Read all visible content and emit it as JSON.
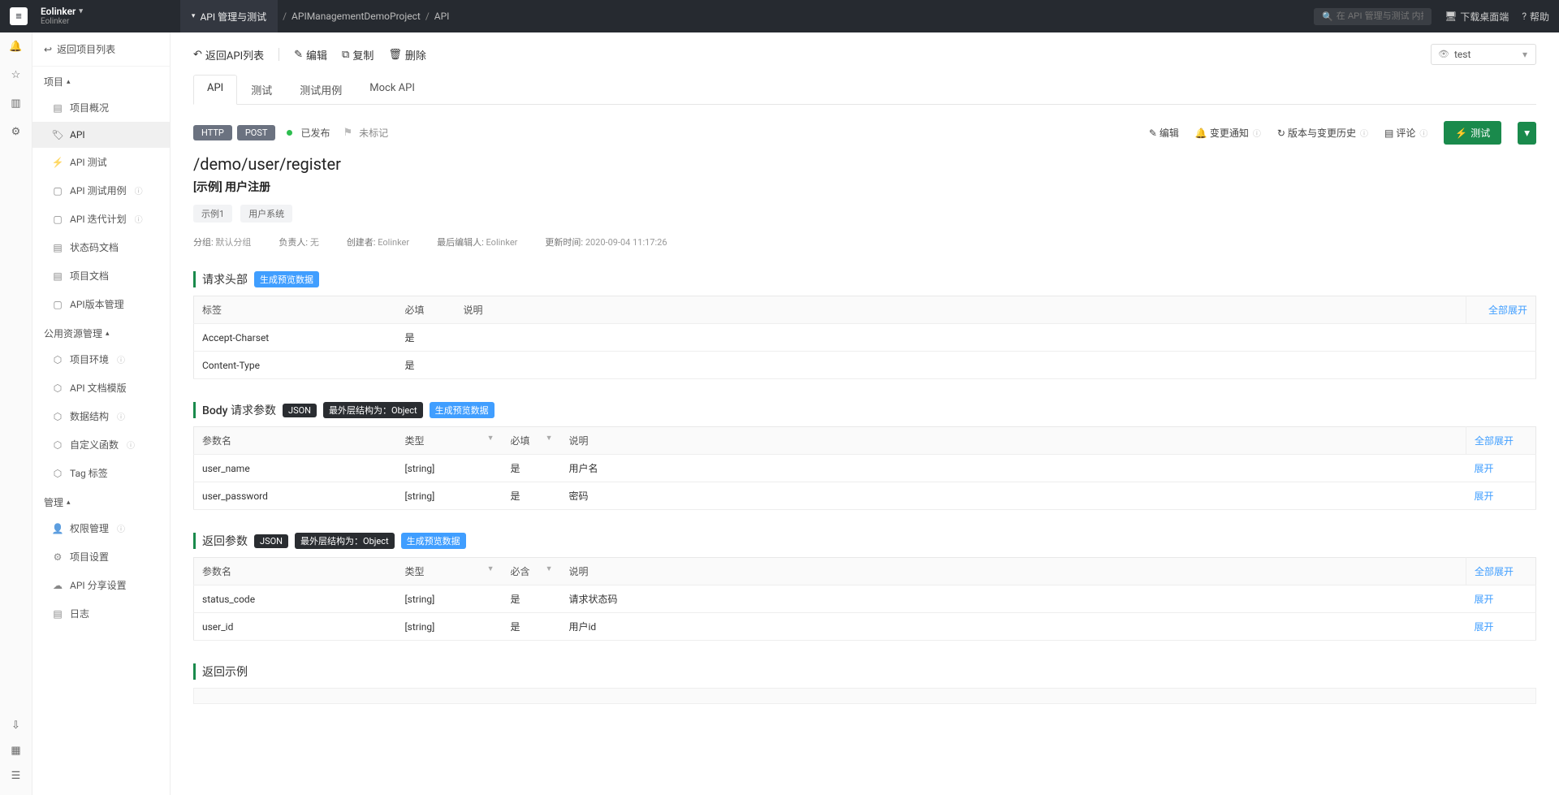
{
  "topbar": {
    "workspace_name": "Eolinker",
    "workspace_sub": "Eolinker",
    "breadcrumb_tab": "API 管理与测试",
    "breadcrumb_project": "APIManagementDemoProject",
    "breadcrumb_leaf": "API",
    "search_placeholder": "在 API 管理与测试 内搜索",
    "download": "下载桌面端",
    "help": "帮助"
  },
  "sidebar": {
    "back": "返回项目列表",
    "group1_title": "项目",
    "group1_items": [
      "项目概况",
      "API",
      "API 测试",
      "API 测试用例",
      "API 迭代计划",
      "状态码文档",
      "项目文档",
      "API版本管理"
    ],
    "group2_title": "公用资源管理",
    "group2_items": [
      "项目环境",
      "API 文档模版",
      "数据结构",
      "自定义函数",
      "Tag 标签"
    ],
    "group3_title": "管理",
    "group3_items": [
      "权限管理",
      "项目设置",
      "API 分享设置",
      "日志"
    ]
  },
  "toolbar": {
    "back": "返回API列表",
    "edit": "编辑",
    "copy": "复制",
    "delete": "删除",
    "env_value": "test"
  },
  "tabs": [
    "API",
    "测试",
    "测试用例",
    "Mock API"
  ],
  "api": {
    "protocol": "HTTP",
    "method": "POST",
    "status": "已发布",
    "flag": "未标记",
    "path": "/demo/user/register",
    "title": "[示例] 用户注册",
    "tags": [
      "示例1",
      "用户系统"
    ],
    "meta": {
      "group_label": "分组:",
      "group": "默认分组",
      "owner_label": "负责人:",
      "owner": "无",
      "creator_label": "创建者:",
      "creator": "Eolinker",
      "editor_label": "最后编辑人:",
      "editor": "Eolinker",
      "updated_label": "更新时间:",
      "updated": "2020-09-04 11:17:26"
    },
    "actions": {
      "edit": "编辑",
      "notify": "变更通知",
      "history": "版本与变更历史",
      "comment": "评论",
      "test": "测试"
    }
  },
  "sections": {
    "request_header_title": "请求头部",
    "gen_demo": "生成预览数据",
    "body_title": "Body 请求参数",
    "json_badge": "JSON",
    "struct_badge": "最外层结构为：Object",
    "return_title": "返回参数",
    "return_example_title": "返回示例",
    "expand_all": "全部展开",
    "expand": "展开"
  },
  "headers_table": {
    "cols": [
      "标签",
      "必填",
      "说明"
    ],
    "rows": [
      {
        "tag": "Accept-Charset",
        "required": "是",
        "desc": ""
      },
      {
        "tag": "Content-Type",
        "required": "是",
        "desc": ""
      }
    ]
  },
  "body_table": {
    "cols": [
      "参数名",
      "类型",
      "必填",
      "说明"
    ],
    "rows": [
      {
        "name": "user_name",
        "type": "[string]",
        "required": "是",
        "desc": "用户名"
      },
      {
        "name": "user_password",
        "type": "[string]",
        "required": "是",
        "desc": "密码"
      }
    ]
  },
  "return_table": {
    "cols": [
      "参数名",
      "类型",
      "必含",
      "说明"
    ],
    "rows": [
      {
        "name": "status_code",
        "type": "[string]",
        "required": "是",
        "desc": "请求状态码"
      },
      {
        "name": "user_id",
        "type": "[string]",
        "required": "是",
        "desc": "用户id"
      }
    ]
  }
}
